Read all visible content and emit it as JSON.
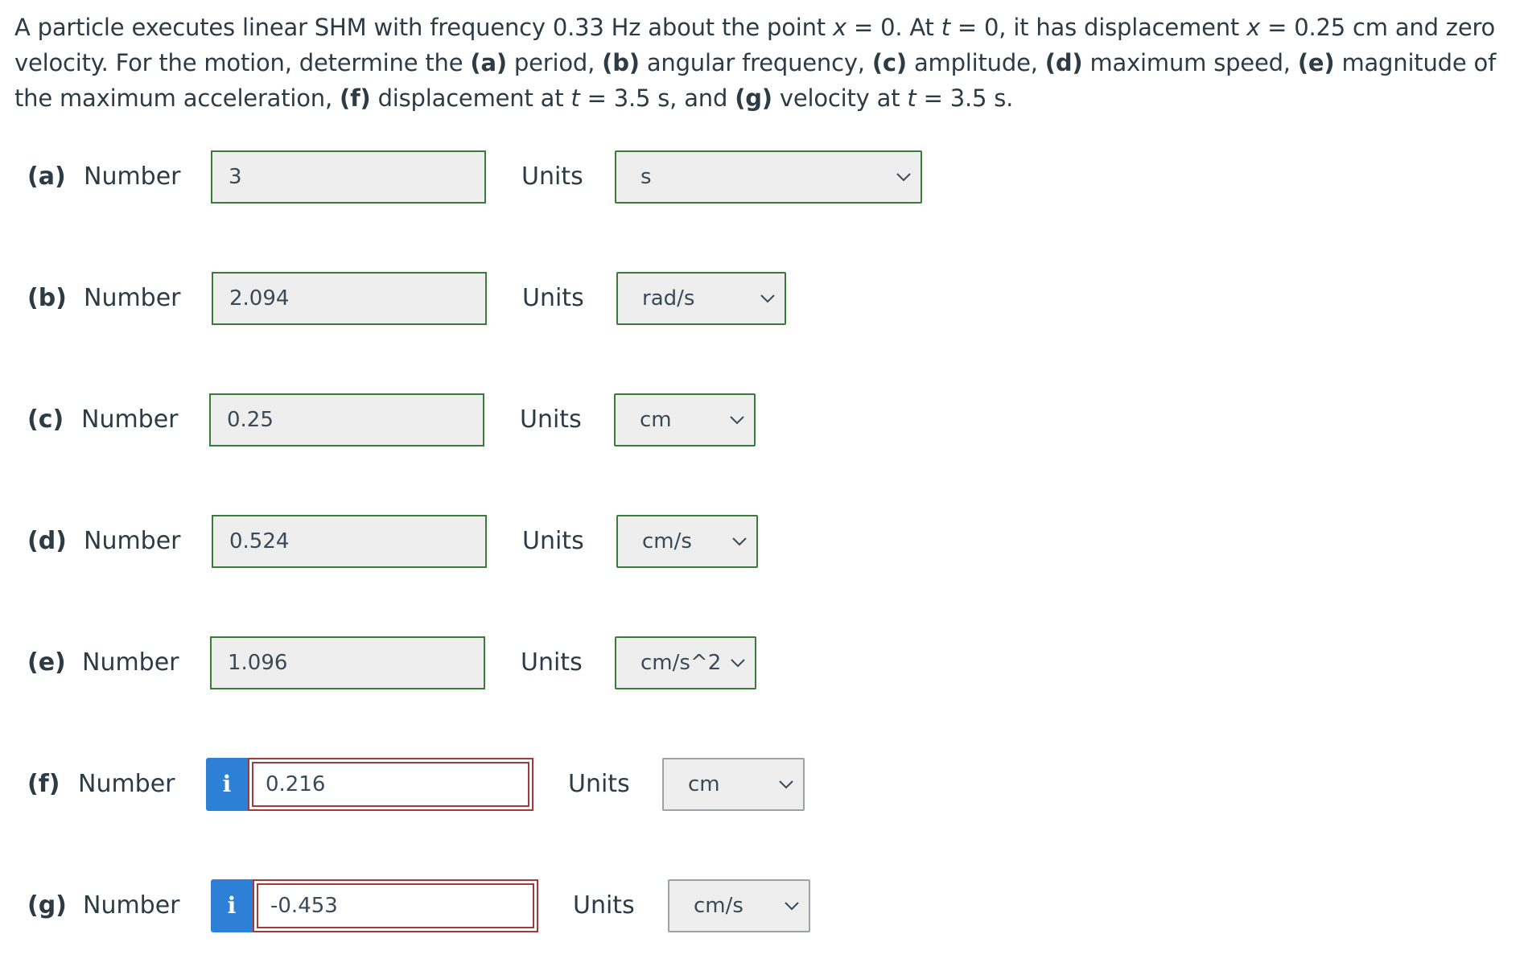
{
  "question": {
    "text_1": "A particle executes linear SHM with frequency 0.33 Hz about the point ",
    "var_x1": "x",
    "text_2": " = 0. At ",
    "var_t1": "t",
    "text_3": " = 0, it has displacement ",
    "var_x2": "x",
    "text_4": " = 0.25 cm and zero velocity. For the motion, determine the ",
    "part_a": "(a)",
    "text_a": " period, ",
    "part_b": "(b)",
    "text_b": " angular frequency, ",
    "part_c": "(c)",
    "text_c": " amplitude, ",
    "part_d": "(d)",
    "text_d": " maximum speed, ",
    "part_e": "(e)",
    "text_e": " magnitude of the maximum acceleration, ",
    "part_f": "(f)",
    "text_f": " displacement at ",
    "var_t2": "t",
    "text_f2": " = 3.5 s, and ",
    "part_g": "(g)",
    "text_g": " velocity at ",
    "var_t3": "t",
    "text_g2": " = 3.5 s."
  },
  "number_label": "Number",
  "units_label": "Units",
  "info_icon": "i",
  "answers": [
    {
      "part": "(a)",
      "value": "3",
      "unit": "s",
      "status": "correct"
    },
    {
      "part": "(b)",
      "value": "2.094",
      "unit": "rad/s",
      "status": "correct"
    },
    {
      "part": "(c)",
      "value": "0.25",
      "unit": "cm",
      "status": "correct"
    },
    {
      "part": "(d)",
      "value": "0.524",
      "unit": "cm/s",
      "status": "correct"
    },
    {
      "part": "(e)",
      "value": "1.096",
      "unit": "cm/s^2",
      "status": "correct"
    },
    {
      "part": "(f)",
      "value": "0.216",
      "unit": "cm",
      "status": "incorrect"
    },
    {
      "part": "(g)",
      "value": "-0.453",
      "unit": "cm/s",
      "status": "incorrect"
    }
  ],
  "colors": {
    "correct_border": "#3c7a3c",
    "incorrect_border": "#a33a3a",
    "info_blue": "#2e80d6"
  }
}
